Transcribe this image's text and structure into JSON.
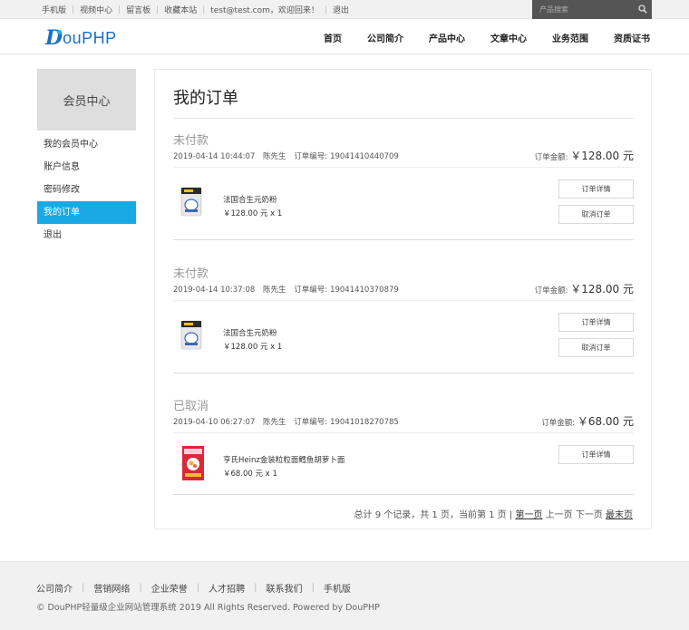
{
  "topbar": {
    "links": [
      "手机版",
      "视频中心",
      "留言板",
      "收藏本站",
      "test@test.com，欢迎回来！",
      "退出"
    ],
    "search_placeholder": "产品搜索"
  },
  "header": {
    "logo_text": "DouPHP",
    "logo_letter": "D",
    "logo_rest": "ouPHP",
    "nav": [
      "首页",
      "公司简介",
      "产品中心",
      "文章中心",
      "业务范围",
      "资质证书"
    ]
  },
  "sidebar": {
    "title": "会员中心",
    "items": [
      "我的会员中心",
      "账户信息",
      "密码修改",
      "我的订单",
      "退出"
    ],
    "active_index": 3
  },
  "main": {
    "title": "我的订单",
    "amount_label": "订单金额:",
    "orders": [
      {
        "status": "未付款",
        "time": "2019-04-14 10:44:07",
        "customer": "陈先生",
        "order_no_label": "订单编号:",
        "order_no": "19041410440709",
        "amount": "￥128.00 元",
        "product_name": "法国合生元奶粉",
        "product_price": "￥128.00 元 x 1",
        "product_icon": "milk-powder-can",
        "buttons": [
          "订单详情",
          "取消订单"
        ]
      },
      {
        "status": "未付款",
        "time": "2019-04-14 10:37:08",
        "customer": "陈先生",
        "order_no_label": "订单编号:",
        "order_no": "19041410370879",
        "amount": "￥128.00 元",
        "product_name": "法国合生元奶粉",
        "product_price": "￥128.00 元 x 1",
        "product_icon": "milk-powder-can",
        "buttons": [
          "订单详情",
          "取消订单"
        ]
      },
      {
        "status": "已取消",
        "time": "2019-04-10 06:27:07",
        "customer": "陈先生",
        "order_no_label": "订单编号:",
        "order_no": "19041018270785",
        "amount": "￥68.00 元",
        "product_name": "亨氏Heinz金装粒粒面鳕鱼胡萝卜面",
        "product_price": "￥68.00 元 x 1",
        "product_icon": "noodle-box",
        "buttons": [
          "订单详情"
        ]
      }
    ],
    "pager": {
      "summary": "总计 9 个记录，共 1 页，当前第 1 页 |",
      "first": "第一页",
      "prev": "上一页",
      "next": "下一页",
      "last": "最末页"
    }
  },
  "footer": {
    "links": [
      "公司简介",
      "营销网络",
      "企业荣誉",
      "人才招聘",
      "联系我们",
      "手机版"
    ],
    "copyright": "© DouPHP轻量级企业网站管理系统 2019 All Rights Reserved. Powered by DouPHP"
  },
  "colors": {
    "accent": "#19a9e5",
    "logo": "#1a6fc4",
    "search_bg": "#555555"
  }
}
